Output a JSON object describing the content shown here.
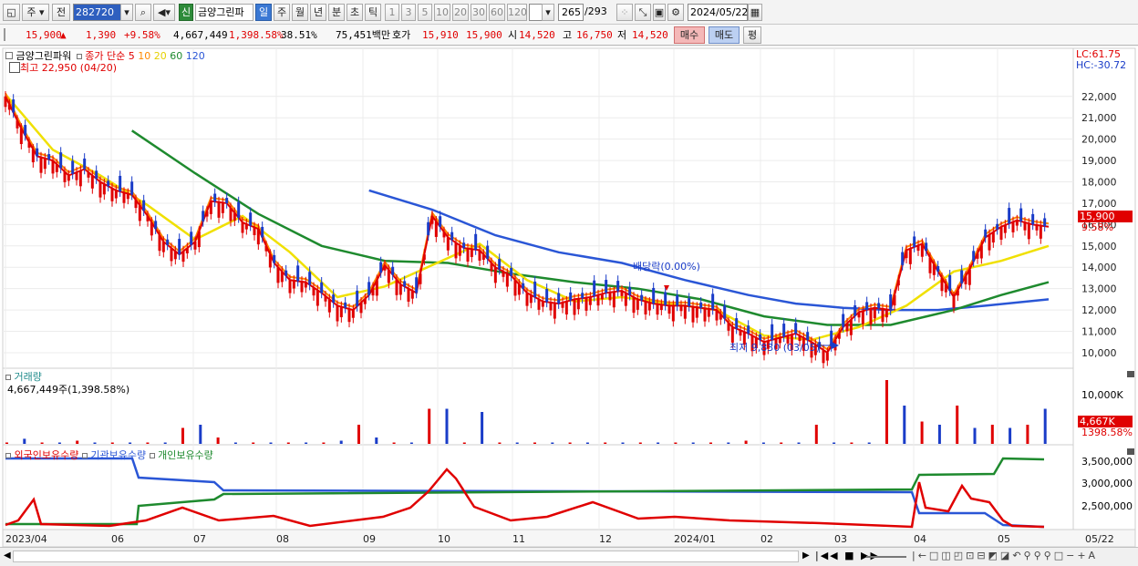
{
  "toolbar": {
    "period_type": "주",
    "prev_label": "전",
    "code": "282720",
    "stock_name": "금양그린파",
    "badge_new": "신",
    "periods": [
      "일",
      "주",
      "월",
      "년",
      "분",
      "초",
      "틱"
    ],
    "selected_period": "일",
    "counts": [
      "1",
      "3",
      "5",
      "10",
      "20",
      "30",
      "60",
      "120"
    ],
    "page_count": "265",
    "page_total": "/293",
    "date": "2024/05/22"
  },
  "quote": {
    "price": "15,900",
    "change_arrow": "▲",
    "change": "1,390",
    "change_pct": "+9.58%",
    "volume": "4,667,449",
    "volume_pct": "1,398.58%",
    "turnover": "38.51%",
    "amount": "75,451백만",
    "ask_label": "호가",
    "ask1": "15,910",
    "bid1": "15,900",
    "open_label": "시",
    "open": "14,520",
    "high_label": "고",
    "high": "16,750",
    "low_label": "저",
    "low": "14,520",
    "buy_label": "매수",
    "sell_label": "매도",
    "avg_label": "평"
  },
  "price_panel": {
    "title": "금양그린파워",
    "legend_prefix": "종가 단순",
    "ma_labels": [
      "5",
      "10",
      "20",
      "60",
      "120"
    ],
    "ma_colors": [
      "#e00000",
      "#ff8800",
      "#f0e000",
      "#1e8a2e",
      "#2a56d6"
    ],
    "max_note": "최고 22,950 (04/20)",
    "min_note": "최저 9,830 (03/05)",
    "dividend_note": "배당락(0.00%)",
    "lc_label": "LC:61.75",
    "hc_label": "HC:-30.72",
    "current_price_tag": "15,900",
    "current_pct_tag": "9.58%"
  },
  "volume_panel": {
    "title": "거래량",
    "value": "4,667,449주(1,398.58%)",
    "axis_label": "10,000K",
    "current_tag": "4,667K",
    "current_pct": "1398.58%"
  },
  "holdings_panel": {
    "legend": [
      "외국인보유수량",
      "기관보유수량",
      "개인보유수량"
    ],
    "colors": [
      "#e00000",
      "#2a56d6",
      "#1e8a2e"
    ],
    "y_labels": [
      "3,500,000",
      "3,000,000",
      "2,500,000"
    ]
  },
  "x_axis": {
    "labels": [
      "2023/04",
      "06",
      "07",
      "08",
      "09",
      "10",
      "11",
      "12",
      "2024/01",
      "02",
      "03",
      "04",
      "05"
    ],
    "right_label": "05/22"
  },
  "chart_data": {
    "type": "candlestick",
    "title": "금양그린파워",
    "y_ticks": [
      "22,000",
      "21,000",
      "20,000",
      "19,000",
      "18,000",
      "17,000",
      "16,000",
      "15,000",
      "14,000",
      "13,000",
      "12,000",
      "11,000",
      "10,000"
    ],
    "ylim": [
      9400,
      23400
    ],
    "close_path": [
      [
        0,
        22000
      ],
      [
        2,
        20500
      ],
      [
        4,
        19200
      ],
      [
        6,
        19000
      ],
      [
        8,
        18300
      ],
      [
        10,
        18600
      ],
      [
        12,
        18000
      ],
      [
        14,
        17600
      ],
      [
        16,
        17400
      ],
      [
        18,
        16400
      ],
      [
        20,
        15200
      ],
      [
        22,
        14600
      ],
      [
        24,
        15200
      ],
      [
        26,
        17100
      ],
      [
        28,
        17000
      ],
      [
        30,
        16100
      ],
      [
        32,
        15800
      ],
      [
        34,
        14200
      ],
      [
        36,
        13400
      ],
      [
        38,
        13300
      ],
      [
        40,
        12800
      ],
      [
        42,
        12200
      ],
      [
        44,
        12000
      ],
      [
        46,
        12700
      ],
      [
        48,
        14100
      ],
      [
        50,
        13200
      ],
      [
        52,
        12800
      ],
      [
        54,
        16400
      ],
      [
        56,
        15400
      ],
      [
        58,
        14900
      ],
      [
        60,
        14800
      ],
      [
        62,
        14000
      ],
      [
        64,
        13600
      ],
      [
        66,
        12800
      ],
      [
        68,
        12400
      ],
      [
        70,
        12300
      ],
      [
        72,
        12500
      ],
      [
        74,
        12600
      ],
      [
        76,
        12800
      ],
      [
        78,
        12900
      ],
      [
        80,
        12500
      ],
      [
        82,
        12300
      ],
      [
        84,
        12200
      ],
      [
        86,
        12200
      ],
      [
        88,
        12100
      ],
      [
        90,
        12000
      ],
      [
        92,
        11200
      ],
      [
        94,
        10900
      ],
      [
        96,
        10500
      ],
      [
        98,
        10700
      ],
      [
        100,
        10900
      ],
      [
        102,
        10500
      ],
      [
        104,
        10000
      ],
      [
        106,
        11200
      ],
      [
        108,
        11900
      ],
      [
        110,
        12100
      ],
      [
        112,
        12000
      ],
      [
        114,
        14800
      ],
      [
        116,
        15100
      ],
      [
        118,
        13800
      ],
      [
        120,
        12600
      ],
      [
        122,
        13900
      ],
      [
        124,
        15400
      ],
      [
        126,
        15900
      ],
      [
        128,
        16200
      ],
      [
        130,
        16000
      ],
      [
        132,
        15900
      ]
    ],
    "ma20": [
      [
        0,
        22100
      ],
      [
        6,
        19500
      ],
      [
        12,
        18300
      ],
      [
        18,
        16900
      ],
      [
        24,
        15300
      ],
      [
        30,
        16400
      ],
      [
        36,
        14700
      ],
      [
        42,
        12600
      ],
      [
        48,
        13100
      ],
      [
        54,
        14100
      ],
      [
        60,
        15100
      ],
      [
        66,
        13400
      ],
      [
        72,
        12400
      ],
      [
        78,
        12600
      ],
      [
        84,
        12300
      ],
      [
        90,
        12000
      ],
      [
        96,
        10800
      ],
      [
        102,
        10600
      ],
      [
        108,
        11200
      ],
      [
        114,
        12200
      ],
      [
        120,
        13800
      ],
      [
        126,
        14300
      ],
      [
        132,
        15000
      ]
    ],
    "ma60": [
      [
        16,
        20400
      ],
      [
        24,
        18400
      ],
      [
        32,
        16500
      ],
      [
        40,
        15000
      ],
      [
        48,
        14300
      ],
      [
        56,
        14200
      ],
      [
        64,
        13700
      ],
      [
        72,
        13300
      ],
      [
        80,
        13000
      ],
      [
        88,
        12500
      ],
      [
        96,
        11700
      ],
      [
        104,
        11300
      ],
      [
        112,
        11300
      ],
      [
        120,
        12000
      ],
      [
        126,
        12700
      ],
      [
        132,
        13300
      ]
    ],
    "ma120": [
      [
        46,
        17600
      ],
      [
        54,
        16700
      ],
      [
        62,
        15500
      ],
      [
        70,
        14700
      ],
      [
        78,
        14200
      ],
      [
        86,
        13400
      ],
      [
        94,
        12700
      ],
      [
        100,
        12300
      ],
      [
        106,
        12100
      ],
      [
        112,
        12000
      ],
      [
        118,
        12000
      ],
      [
        124,
        12200
      ],
      [
        132,
        12500
      ]
    ],
    "volume_series": [
      0,
      0.08,
      0,
      0,
      0.05,
      0,
      0,
      0,
      0,
      0,
      0.25,
      0.3,
      0.1,
      0,
      0,
      0,
      0,
      0,
      0,
      0.05,
      0.3,
      0.1,
      0,
      0,
      0.55,
      0.55,
      0,
      0.5,
      0,
      0,
      0,
      0,
      0,
      0,
      0,
      0,
      0,
      0,
      0,
      0,
      0,
      0,
      0.05,
      0,
      0,
      0,
      0.3,
      0,
      0,
      0,
      1.0,
      0.6,
      0.35,
      0.3,
      0.6,
      0.25,
      0.3,
      0.25,
      0.3,
      0.55
    ]
  }
}
